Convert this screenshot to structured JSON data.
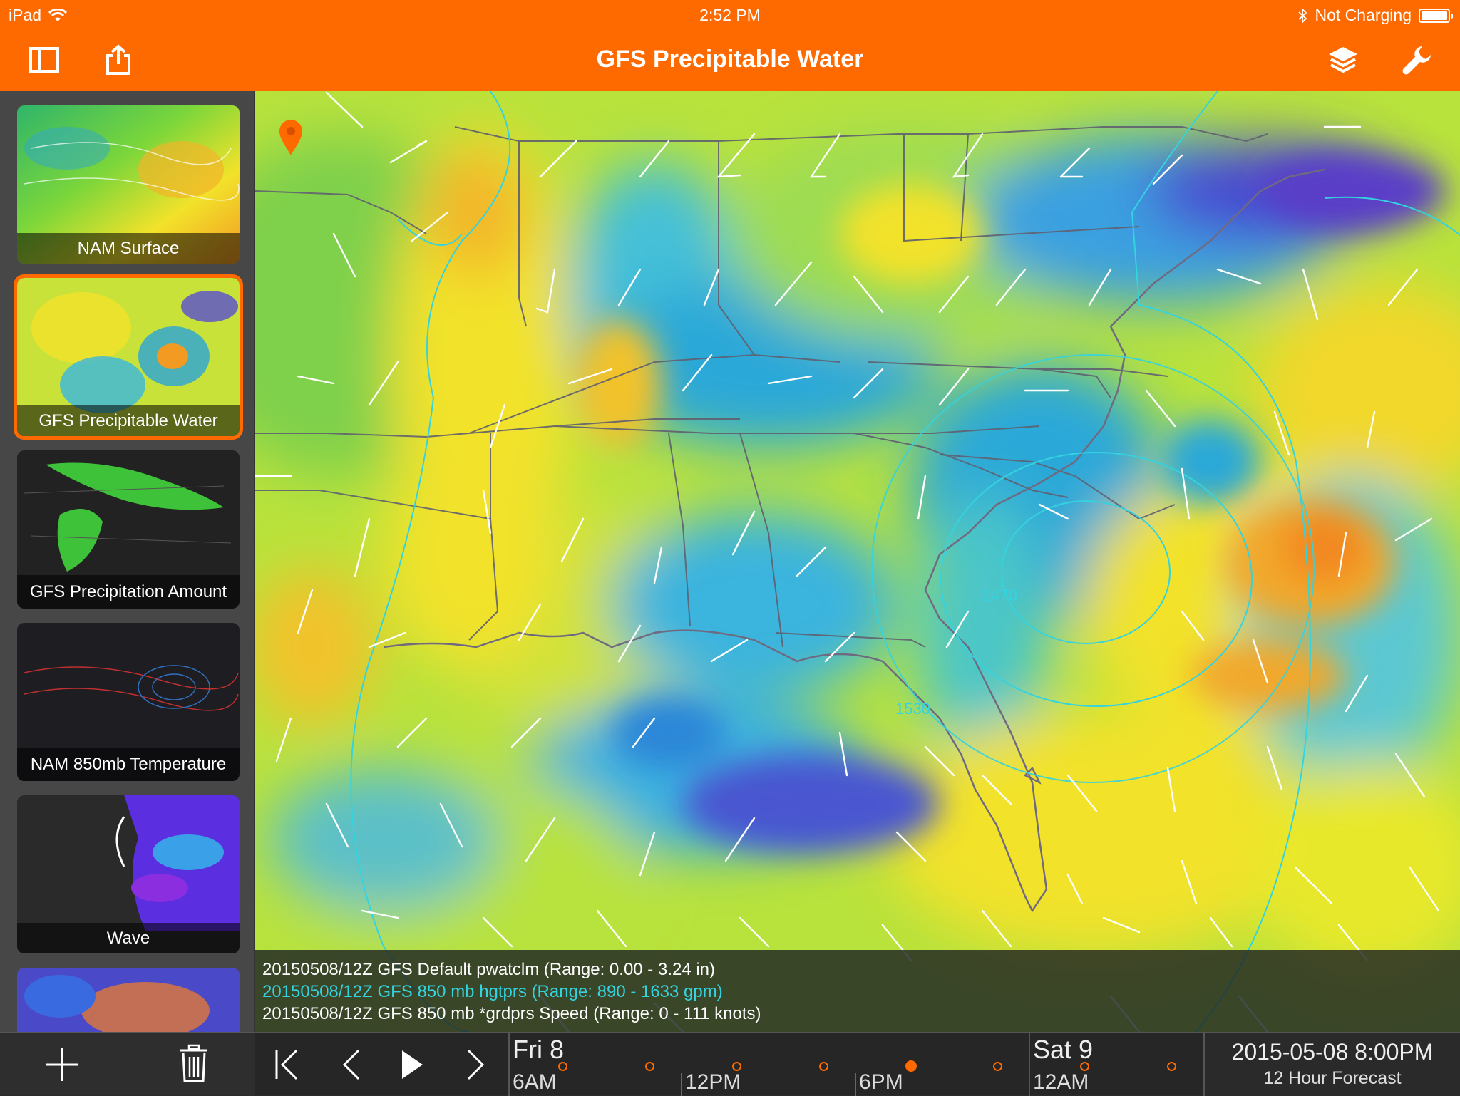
{
  "status": {
    "device": "iPad",
    "time": "2:52 PM",
    "charging": "Not Charging"
  },
  "nav": {
    "title": "GFS Precipitable Water"
  },
  "sidebar": {
    "items": [
      {
        "label": "NAM Surface"
      },
      {
        "label": "GFS Precipitable Water",
        "selected": true
      },
      {
        "label": "GFS Precipitation Amount"
      },
      {
        "label": "NAM 850mb Temperature"
      },
      {
        "label": "Wave"
      }
    ]
  },
  "map": {
    "contour_labels": [
      "1470",
      "1530"
    ]
  },
  "legend": {
    "lines": [
      {
        "text": "20150508/12Z GFS Default pwatclm (Range: 0.00 - 3.24 in)",
        "color": "#ffffff"
      },
      {
        "text": "20150508/12Z GFS 850 mb hgtprs (Range: 890 - 1633 gpm)",
        "color": "#34d3e0"
      },
      {
        "text": "20150508/12Z GFS 850 mb *grdprs Speed (Range: 0 - 111 knots)",
        "color": "#ffffff"
      }
    ]
  },
  "timeline": {
    "days": [
      {
        "label": "Fri 8"
      },
      {
        "label": "Sat 9"
      }
    ],
    "hours": [
      "6AM",
      "12PM",
      "6PM",
      "12AM"
    ],
    "forecast_date": "2015-05-08 8:00PM",
    "forecast_sub": "12 Hour Forecast"
  },
  "colors": {
    "accent": "#ff6a00",
    "contour": "#34d3e0"
  }
}
